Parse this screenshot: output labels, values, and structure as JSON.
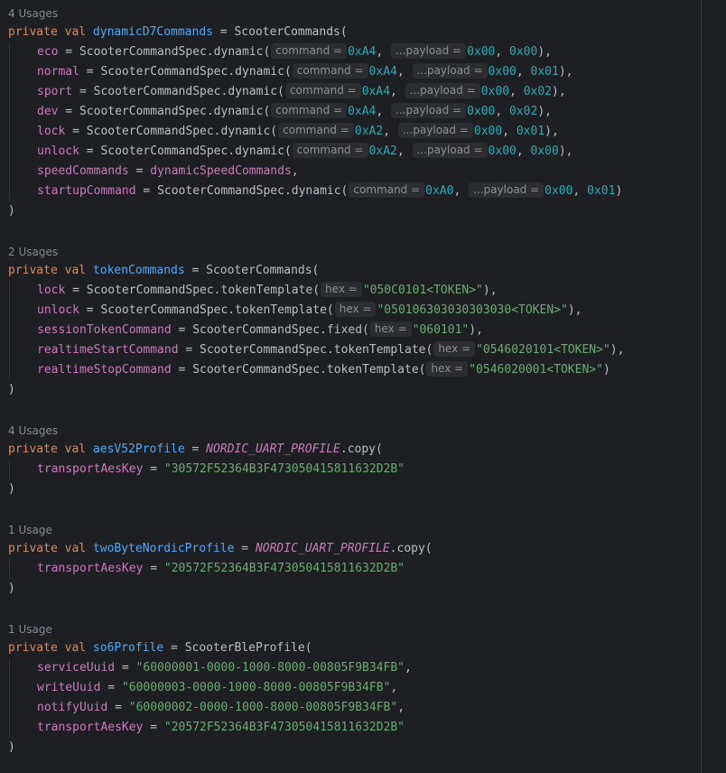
{
  "blocks": [
    {
      "usage": "4 Usages",
      "decl": {
        "kw": "private val",
        "name": "dynamicD7Commands",
        "eq": " = ",
        "call": "ScooterCommands("
      },
      "lines": [
        {
          "prop": "eco",
          "eq": " = ",
          "call": "ScooterCommandSpec.dynamic(",
          "args": [
            {
              "hint": "command =",
              "val": "0xA4",
              "type": "num"
            },
            {
              "hint": "...payload =",
              "val": "0x00, 0x00",
              "type": "num"
            }
          ],
          "tail": "),"
        },
        {
          "prop": "normal",
          "eq": " = ",
          "call": "ScooterCommandSpec.dynamic(",
          "args": [
            {
              "hint": "command =",
              "val": "0xA4",
              "type": "num"
            },
            {
              "hint": "...payload =",
              "val": "0x00, 0x01",
              "type": "num"
            }
          ],
          "tail": "),"
        },
        {
          "prop": "sport",
          "eq": " = ",
          "call": "ScooterCommandSpec.dynamic(",
          "args": [
            {
              "hint": "command =",
              "val": "0xA4",
              "type": "num"
            },
            {
              "hint": "...payload =",
              "val": "0x00, 0x02",
              "type": "num"
            }
          ],
          "tail": "),"
        },
        {
          "prop": "dev",
          "eq": " = ",
          "call": "ScooterCommandSpec.dynamic(",
          "args": [
            {
              "hint": "command =",
              "val": "0xA4",
              "type": "num"
            },
            {
              "hint": "...payload =",
              "val": "0x00, 0x02",
              "type": "num"
            }
          ],
          "tail": "),"
        },
        {
          "prop": "lock",
          "eq": " = ",
          "call": "ScooterCommandSpec.dynamic(",
          "args": [
            {
              "hint": "command =",
              "val": "0xA2",
              "type": "num"
            },
            {
              "hint": "...payload =",
              "val": "0x00, 0x01",
              "type": "num"
            }
          ],
          "tail": "),"
        },
        {
          "prop": "unlock",
          "eq": " = ",
          "call": "ScooterCommandSpec.dynamic(",
          "args": [
            {
              "hint": "command =",
              "val": "0xA2",
              "type": "num"
            },
            {
              "hint": "...payload =",
              "val": "0x00, 0x00",
              "type": "num"
            }
          ],
          "tail": "),"
        },
        {
          "prop": "speedCommands",
          "eq": " = ",
          "ref": "dynamicSpeedCommands",
          "tail": ","
        },
        {
          "prop": "startupCommand",
          "eq": " = ",
          "call": "ScooterCommandSpec.dynamic(",
          "args": [
            {
              "hint": "command =",
              "val": "0xA0",
              "type": "num"
            },
            {
              "hint": "...payload =",
              "val": "0x00, 0x01",
              "type": "num"
            }
          ],
          "tail": ")"
        }
      ],
      "close": ")"
    },
    {
      "usage": "2 Usages",
      "decl": {
        "kw": "private val",
        "name": "tokenCommands",
        "eq": " = ",
        "call": "ScooterCommands("
      },
      "lines": [
        {
          "prop": "lock",
          "eq": " = ",
          "call": "ScooterCommandSpec.tokenTemplate(",
          "args": [
            {
              "hint": "hex =",
              "val": "\"050C0101<TOKEN>\"",
              "type": "str"
            }
          ],
          "tail": "),"
        },
        {
          "prop": "unlock",
          "eq": " = ",
          "call": "ScooterCommandSpec.tokenTemplate(",
          "args": [
            {
              "hint": "hex =",
              "val": "\"050106303030303030<TOKEN>\"",
              "type": "str"
            }
          ],
          "tail": "),"
        },
        {
          "prop": "sessionTokenCommand",
          "eq": " = ",
          "call": "ScooterCommandSpec.fixed(",
          "args": [
            {
              "hint": "hex =",
              "val": "\"060101\"",
              "type": "str"
            }
          ],
          "tail": "),"
        },
        {
          "prop": "realtimeStartCommand",
          "eq": " = ",
          "call": "ScooterCommandSpec.tokenTemplate(",
          "args": [
            {
              "hint": "hex =",
              "val": "\"0546020101<TOKEN>\"",
              "type": "str"
            }
          ],
          "tail": "),"
        },
        {
          "prop": "realtimeStopCommand",
          "eq": " = ",
          "call": "ScooterCommandSpec.tokenTemplate(",
          "args": [
            {
              "hint": "hex =",
              "val": "\"0546020001<TOKEN>\"",
              "type": "str"
            }
          ],
          "tail": ")"
        }
      ],
      "close": ")"
    },
    {
      "usage": "4 Usages",
      "decl": {
        "kw": "private val",
        "name": "aesV52Profile",
        "eq": " = ",
        "constref": "NORDIC_UART_PROFILE",
        "call": ".copy("
      },
      "lines": [
        {
          "prop": "transportAesKey",
          "eq": " = ",
          "strval": "\"30572F52364B3F473050415811632D2B\"",
          "tail": ""
        }
      ],
      "close": ")"
    },
    {
      "usage": "1 Usage",
      "decl": {
        "kw": "private val",
        "name": "twoByteNordicProfile",
        "eq": " = ",
        "constref": "NORDIC_UART_PROFILE",
        "call": ".copy("
      },
      "lines": [
        {
          "prop": "transportAesKey",
          "eq": " = ",
          "strval": "\"20572F52364B3F473050415811632D2B\"",
          "tail": ""
        }
      ],
      "close": ")"
    },
    {
      "usage": "1 Usage",
      "decl": {
        "kw": "private val",
        "name": "so6Profile",
        "eq": " = ",
        "call": "ScooterBleProfile("
      },
      "lines": [
        {
          "prop": "serviceUuid",
          "eq": " = ",
          "strval": "\"60000001-0000-1000-8000-00805F9B34FB\"",
          "tail": ","
        },
        {
          "prop": "writeUuid",
          "eq": " = ",
          "strval": "\"60000003-0000-1000-8000-00805F9B34FB\"",
          "tail": ","
        },
        {
          "prop": "notifyUuid",
          "eq": " = ",
          "strval": "\"60000002-0000-1000-8000-00805F9B34FB\"",
          "tail": ","
        },
        {
          "prop": "transportAesKey",
          "eq": " = ",
          "strval": "\"20572F52364B3F473050415811632D2B\"",
          "tail": ""
        }
      ],
      "close": ")"
    }
  ],
  "colors": {
    "background": "#1e1f22",
    "keyword": "#cf8e6d",
    "declaration": "#56a8f5",
    "property": "#c77dbb",
    "number": "#2aacb8",
    "string": "#6aab73",
    "text": "#bcbec4",
    "usage": "#868a91"
  }
}
